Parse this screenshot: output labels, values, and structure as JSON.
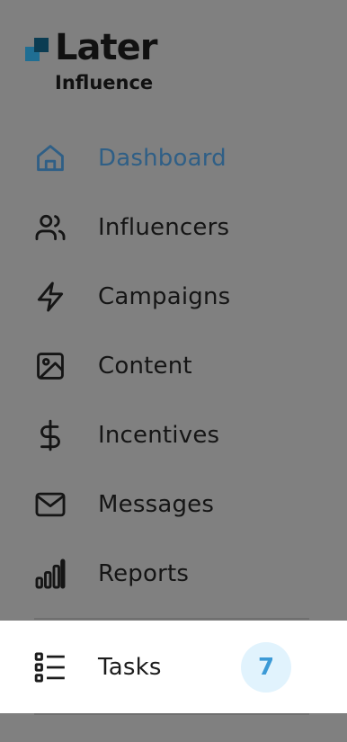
{
  "brand": {
    "name": "Later",
    "product": "Influence"
  },
  "nav": {
    "items": [
      {
        "label": "Dashboard",
        "icon": "home-icon",
        "active": true
      },
      {
        "label": "Influencers",
        "icon": "users-icon"
      },
      {
        "label": "Campaigns",
        "icon": "lightning-icon"
      },
      {
        "label": "Content",
        "icon": "image-icon"
      },
      {
        "label": "Incentives",
        "icon": "dollar-icon"
      },
      {
        "label": "Messages",
        "icon": "mail-icon"
      },
      {
        "label": "Reports",
        "icon": "bar-chart-icon"
      }
    ],
    "tasks": {
      "label": "Tasks",
      "icon": "task-list-icon",
      "badge": "7"
    }
  },
  "colors": {
    "active": "#2f5f86",
    "badge_bg": "#e1f3fd",
    "badge_text": "#3c9ad6",
    "overlay": "#808080"
  }
}
